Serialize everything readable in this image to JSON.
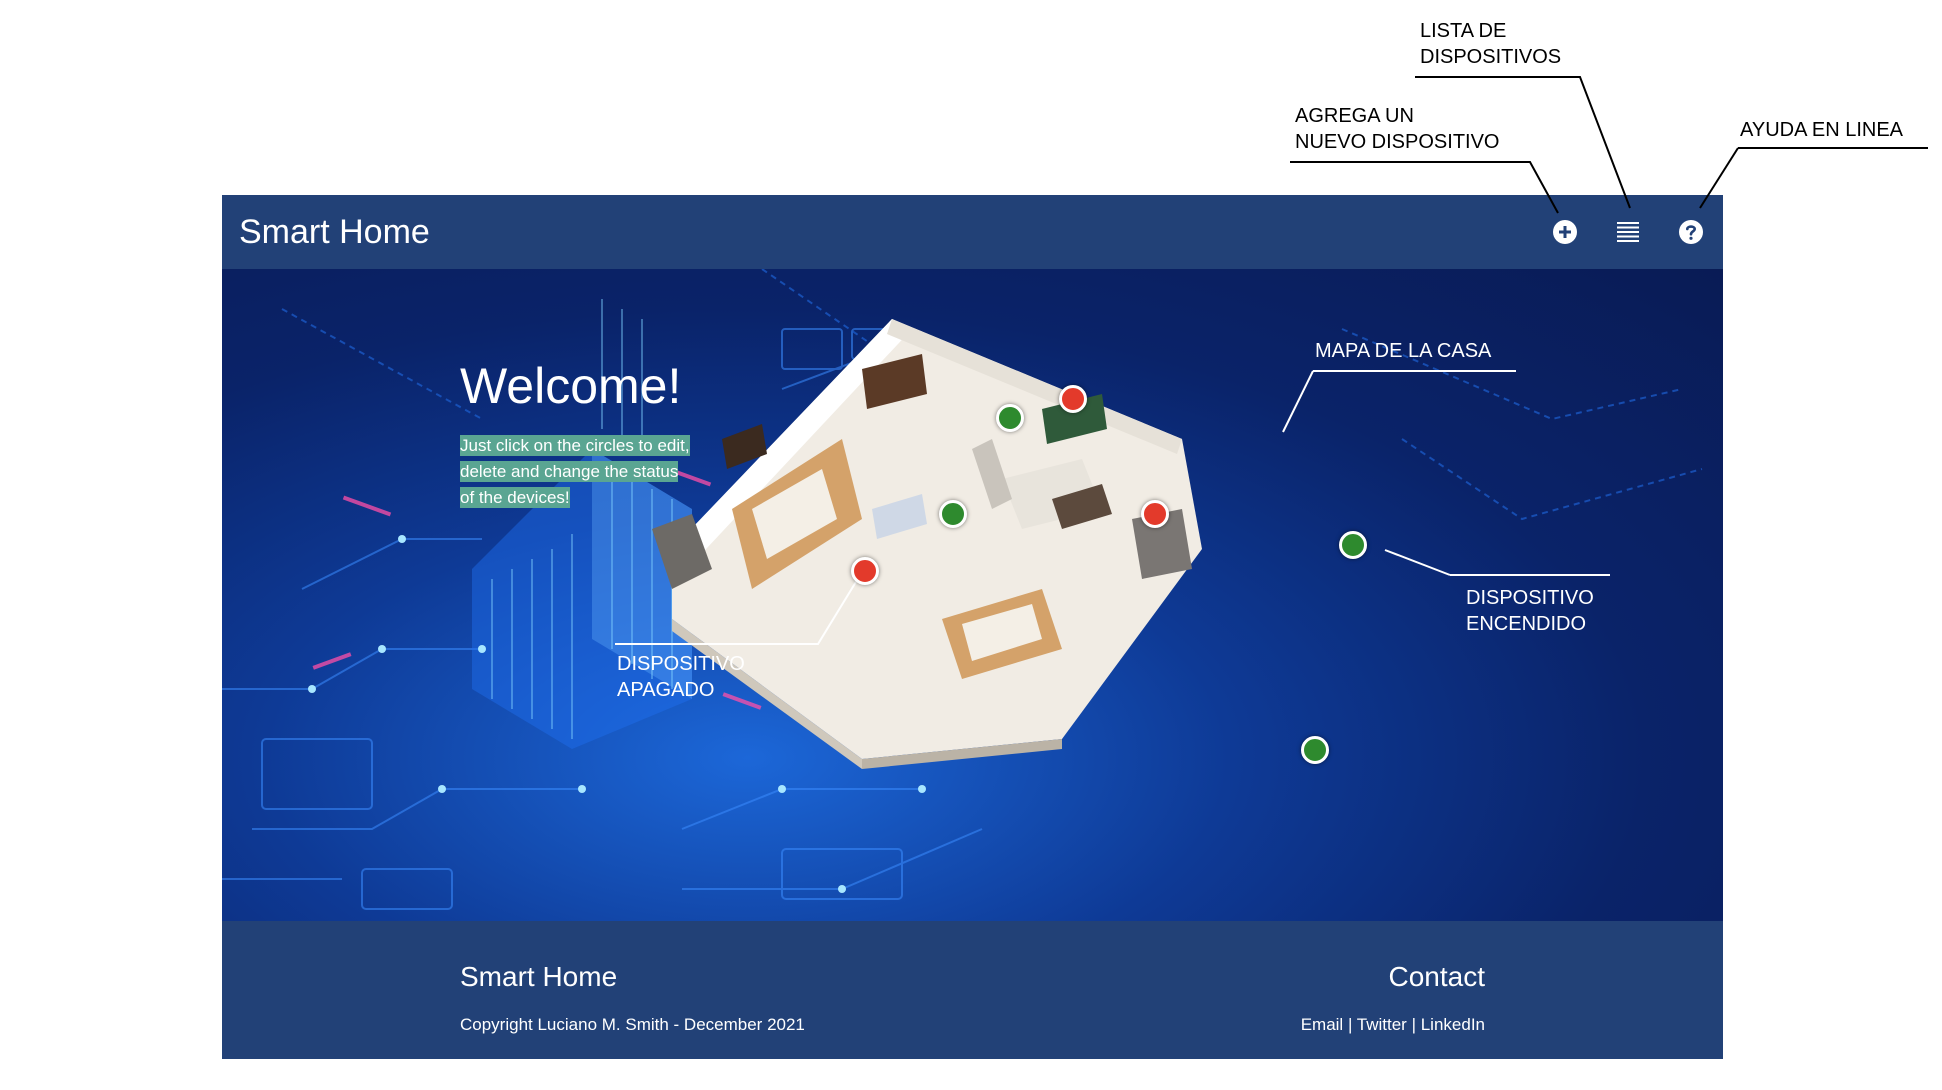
{
  "annotations": {
    "device_list": [
      "LISTA DE",
      "DISPOSITIVOS"
    ],
    "add_device": [
      "AGREGA UN",
      "NUEVO DISPOSITIVO"
    ],
    "help": "AYUDA EN LINEA",
    "house_map": "MAPA DE LA CASA",
    "device_on": [
      "DISPOSITIVO",
      "ENCENDIDO"
    ],
    "device_off": [
      "DISPOSITIVO",
      "APAGADO"
    ]
  },
  "nav": {
    "brand": "Smart Home",
    "icons": [
      "add-circle-icon",
      "list-icon",
      "help-icon"
    ]
  },
  "hero": {
    "welcome": "Welcome!",
    "hint": "Just click on the circles to edit, delete and change the status of the devices!"
  },
  "devices": [
    {
      "status": "on"
    },
    {
      "status": "off"
    },
    {
      "status": "on"
    },
    {
      "status": "off"
    },
    {
      "status": "on"
    },
    {
      "status": "off"
    },
    {
      "status": "on"
    }
  ],
  "footer": {
    "title": "Smart Home",
    "copyright": "Copyright Luciano M. Smith - December 2021",
    "contact_title": "Contact",
    "links": [
      "Email",
      "Twitter",
      "LinkedIn"
    ],
    "separator": " | "
  },
  "colors": {
    "nav_bg": "#224177",
    "device_on": "#2e8a2e",
    "device_off": "#e33a2b",
    "hint_highlight": "#5aa592"
  }
}
